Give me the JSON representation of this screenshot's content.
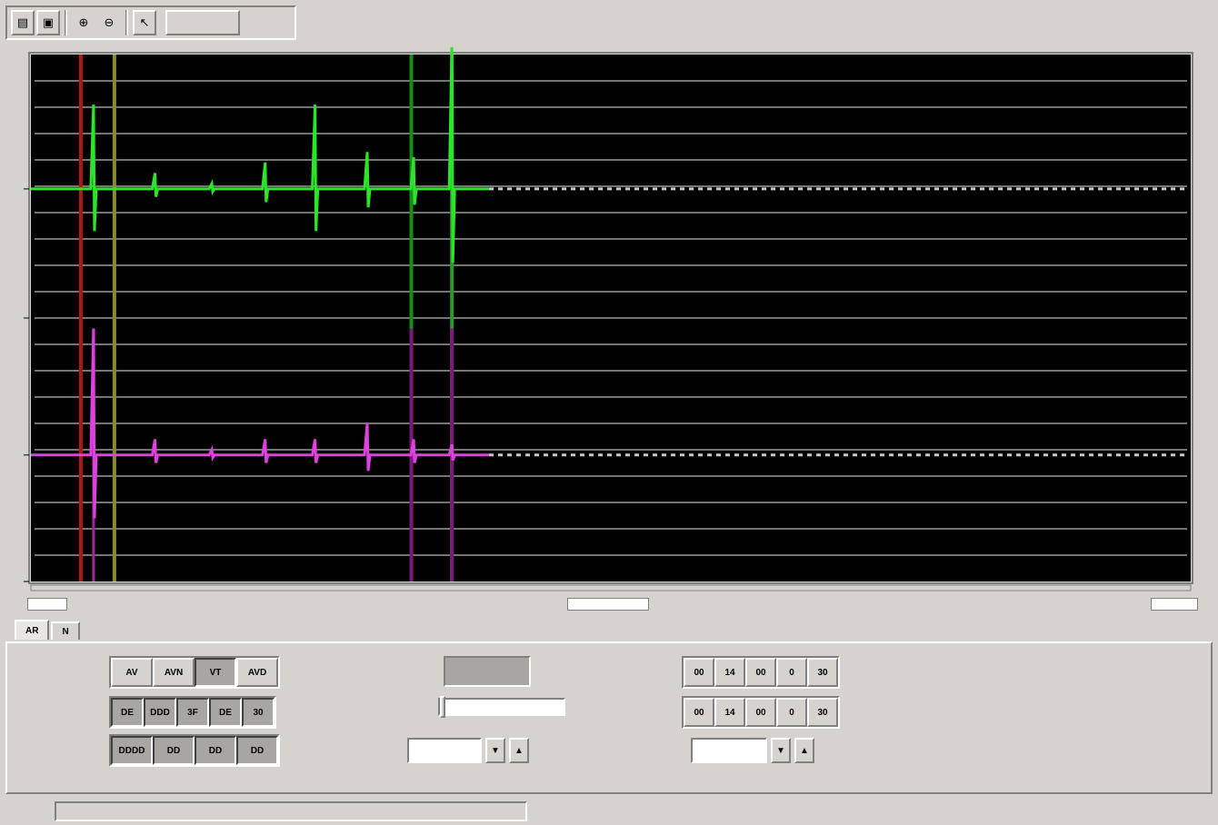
{
  "toolbar": {
    "buttons": [
      {
        "icon": "open-folder-icon",
        "glyph": "▤"
      },
      {
        "icon": "save-disk-icon",
        "glyph": "▣"
      },
      {
        "icon": "zoom-in-icon",
        "glyph": "⊕"
      },
      {
        "icon": "zoom-out-icon",
        "glyph": "⊖"
      },
      {
        "icon": "pointer-icon",
        "glyph": "↖"
      }
    ]
  },
  "chart": {
    "background": "#000000",
    "gridline_color": "#8a8a8a",
    "trace_colors": {
      "green": "#29e629",
      "magenta": "#e040e0"
    },
    "cursor_colors": {
      "red": "#b01818",
      "olive": "#8a8a30",
      "green": "#1a8c1a",
      "magenta": "#8c1a8c"
    }
  },
  "chart_data": {
    "type": "line",
    "series": [
      {
        "color": "#29e629",
        "baseline_fraction": 0.255,
        "spike_x_fraction": [
          0.054,
          0.107,
          0.156,
          0.202,
          0.245,
          0.29,
          0.33,
          0.363
        ],
        "spike_amp": [
          0.16,
          0.03,
          0.01,
          0.05,
          0.16,
          0.07,
          0.06,
          0.28
        ],
        "extent_fraction": 0.395
      },
      {
        "color": "#e040e0",
        "baseline_fraction": 0.76,
        "spike_x_fraction": [
          0.054,
          0.107,
          0.156,
          0.202,
          0.245,
          0.29,
          0.33,
          0.363
        ],
        "spike_amp": [
          0.24,
          0.03,
          0.01,
          0.03,
          0.03,
          0.06,
          0.03,
          0.02
        ],
        "extent_fraction": 0.395
      }
    ],
    "cursors": [
      {
        "x_fraction": 0.043,
        "color": "#b01818"
      },
      {
        "x_fraction": 0.072,
        "color": "#8a8a30"
      },
      {
        "x_fraction": 0.328,
        "color": "#1a8c1a"
      },
      {
        "x_fraction": 0.363,
        "color": "#2a9a2a"
      }
    ]
  },
  "tabs": [
    {
      "label": "AR"
    },
    {
      "label": "N"
    }
  ],
  "panel": {
    "row1_buttons": [
      {
        "label": "AV",
        "pressed": false
      },
      {
        "label": "AVN",
        "pressed": false
      },
      {
        "label": "VT",
        "pressed": true
      },
      {
        "label": "AVD",
        "pressed": false
      }
    ],
    "row2_buttons": [
      {
        "label": "DE",
        "pressed": true
      },
      {
        "label": "DDD",
        "pressed": true
      },
      {
        "label": "3F",
        "pressed": true
      },
      {
        "label": "DE",
        "pressed": true
      },
      {
        "label": "30",
        "pressed": true
      }
    ],
    "row3_buttons": [
      {
        "label": "DDDD",
        "pressed": true
      },
      {
        "label": "DD",
        "pressed": true
      },
      {
        "label": "DD",
        "pressed": true
      },
      {
        "label": "DD",
        "pressed": true
      }
    ],
    "right_row1": [
      "00",
      "14",
      "00",
      "0",
      "30"
    ],
    "right_row2": [
      "00",
      "14",
      "00",
      "0",
      "30"
    ],
    "spin_up": "▲",
    "spin_down": "▼"
  }
}
